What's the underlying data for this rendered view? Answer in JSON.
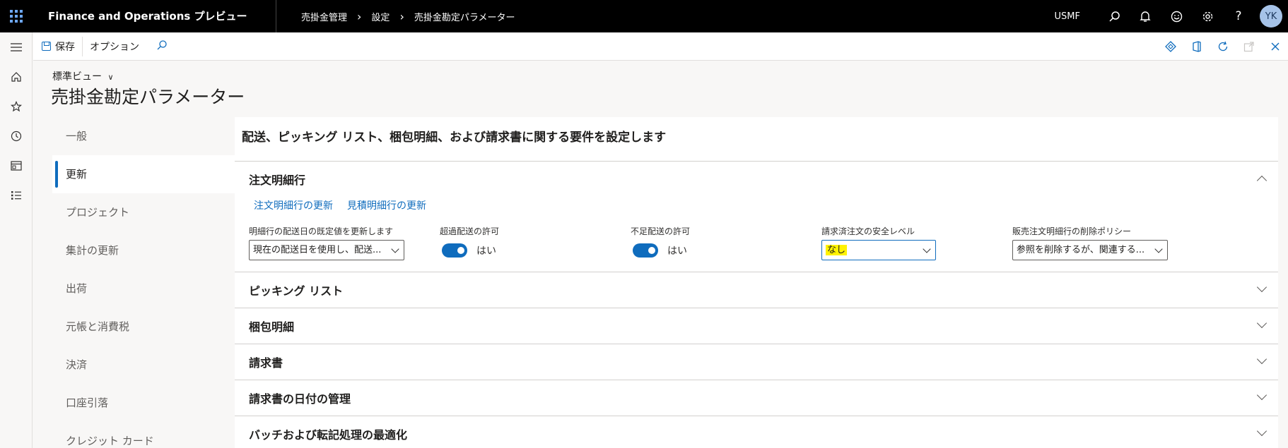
{
  "topbar": {
    "app_title": "Finance and Operations プレビュー",
    "breadcrumb": [
      "売掛金管理",
      "設定",
      "売掛金勘定パラメーター"
    ],
    "company": "USMF",
    "avatar": "YK",
    "icons": [
      "search-icon",
      "bell-icon",
      "smiley-icon",
      "gear-icon",
      "help-icon"
    ]
  },
  "actionbar": {
    "save_label": "保存",
    "options_label": "オプション"
  },
  "header": {
    "view_name": "標準ビュー",
    "page_title": "売掛金勘定パラメーター"
  },
  "vtabs": [
    {
      "label": "一般"
    },
    {
      "label": "更新"
    },
    {
      "label": "プロジェクト"
    },
    {
      "label": "集計の更新"
    },
    {
      "label": "出荷"
    },
    {
      "label": "元帳と消費税"
    },
    {
      "label": "決済"
    },
    {
      "label": "口座引落"
    },
    {
      "label": "クレジット カード"
    }
  ],
  "content": {
    "heading": "配送、ピッキング リスト、梱包明細、および請求書に関する要件を設定します",
    "fasttabs": [
      {
        "title": "注文明細行"
      },
      {
        "title": "ピッキング リスト"
      },
      {
        "title": "梱包明細"
      },
      {
        "title": "請求書"
      },
      {
        "title": "請求書の日付の管理"
      },
      {
        "title": "バッチおよび転記処理の最適化"
      }
    ],
    "order_lines": {
      "links": [
        "注文明細行の更新",
        "見積明細行の更新"
      ],
      "fields": {
        "delivery_date": {
          "label": "明細行の配送日の既定値を更新します",
          "value": "現在の配送日を使用し、配送..."
        },
        "over_delivery": {
          "label": "超過配送の許可",
          "value": "はい"
        },
        "under_delivery": {
          "label": "不足配送の許可",
          "value": "はい"
        },
        "security_level": {
          "label": "請求済注文の安全レベル",
          "value": "なし"
        },
        "delete_policy": {
          "label": "販売注文明細行の削除ポリシー",
          "value": "参照を削除するが、関連する..."
        }
      }
    }
  },
  "colors": {
    "accent": "#0f6cbd",
    "topbar": "#000000",
    "highlight": "#fff200"
  }
}
